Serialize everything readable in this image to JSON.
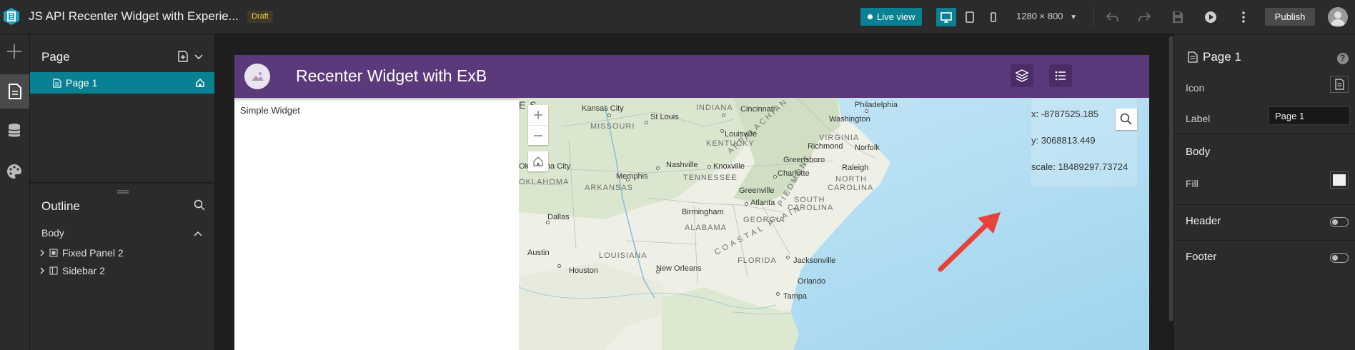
{
  "topbar": {
    "app_title": "JS API Recenter Widget with Experie...",
    "draft_badge": "Draft",
    "live_view_label": "Live view",
    "resolution": "1280 × 800",
    "publish_label": "Publish"
  },
  "left_panel": {
    "page_section_title": "Page",
    "pages": [
      {
        "label": "Page 1"
      }
    ],
    "outline_title": "Outline",
    "outline_body_label": "Body",
    "outline_items": [
      {
        "label": "Fixed Panel 2"
      },
      {
        "label": "Sidebar 2"
      }
    ]
  },
  "app": {
    "header_title": "Recenter Widget with ExB",
    "simple_widget_label": "Simple Widget",
    "readout": {
      "x": "x: -8787525.185",
      "y": "y: 3068813.449",
      "scale": "scale: 18489297.73724"
    },
    "map_labels": {
      "states": [
        "MISSOURI",
        "INDIANA",
        "KENTUCKY",
        "VIRGINIA",
        "TENNESSEE",
        "NORTH",
        "CAROLINA",
        "ARKANSAS",
        "SOUTH",
        "CAROLINA",
        "ALABAMA",
        "GEORGIA",
        "LOUISIANA",
        "FLORIDA",
        "OKLAHOMA",
        "APPALACHIAN",
        "PIEDMONT",
        "COASTAL PLAIN",
        "E S"
      ],
      "cities": [
        "Kansas City",
        "St Louis",
        "Cincinnati",
        "Philadelphia",
        "Washington",
        "Louisville",
        "Richmond",
        "Norfolk",
        "Nashville",
        "Knoxville",
        "Greensboro",
        "Memphis",
        "Charlotte",
        "Raleigh",
        "Greenville",
        "Atlanta",
        "Birmingham",
        "Dallas",
        "Jacksonville",
        "Austin",
        "Houston",
        "New Orleans",
        "Orlando",
        "Tampa",
        "Oklahoma City"
      ]
    }
  },
  "right_panel": {
    "title": "Page 1",
    "icon_label": "Icon",
    "label_label": "Label",
    "label_value": "Page 1",
    "body_title": "Body",
    "fill_label": "Fill",
    "header_title": "Header",
    "footer_title": "Footer"
  },
  "colors": {
    "accent": "#0a8193",
    "app_header": "#5b3a7c",
    "arrow": "#e8433a"
  }
}
